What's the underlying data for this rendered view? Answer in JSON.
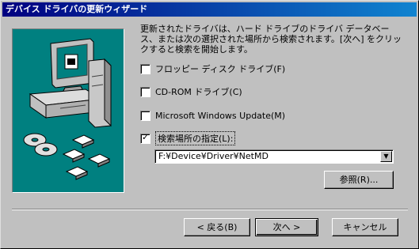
{
  "window": {
    "title": "デバイス ドライバの更新ウィザード"
  },
  "intro_text": "更新されたドライバは、ハード ドライブのドライバ データベース、または次の選択された場所から検索されます。[次へ] をクリックすると検索を開始します。",
  "options": [
    {
      "label": "フロッピー ディスク ドライブ(F)",
      "checked": false
    },
    {
      "label": "CD-ROM ドライブ(C)",
      "checked": false
    },
    {
      "label": "Microsoft Windows Update(M)",
      "checked": false
    },
    {
      "label": "検索場所の指定(L):",
      "checked": true
    }
  ],
  "check_mark": "✓",
  "location": {
    "value": "F:¥Device¥Driver¥NetMD",
    "dropdown_glyph": "▼"
  },
  "buttons": {
    "browse": "参照(R)...",
    "back": "< 戻る(B)",
    "next": "次へ >",
    "cancel": "キャンセル"
  },
  "colors": {
    "titlebar": "#000080",
    "art_background": "#008080",
    "dialog": "#c0c0c0"
  }
}
